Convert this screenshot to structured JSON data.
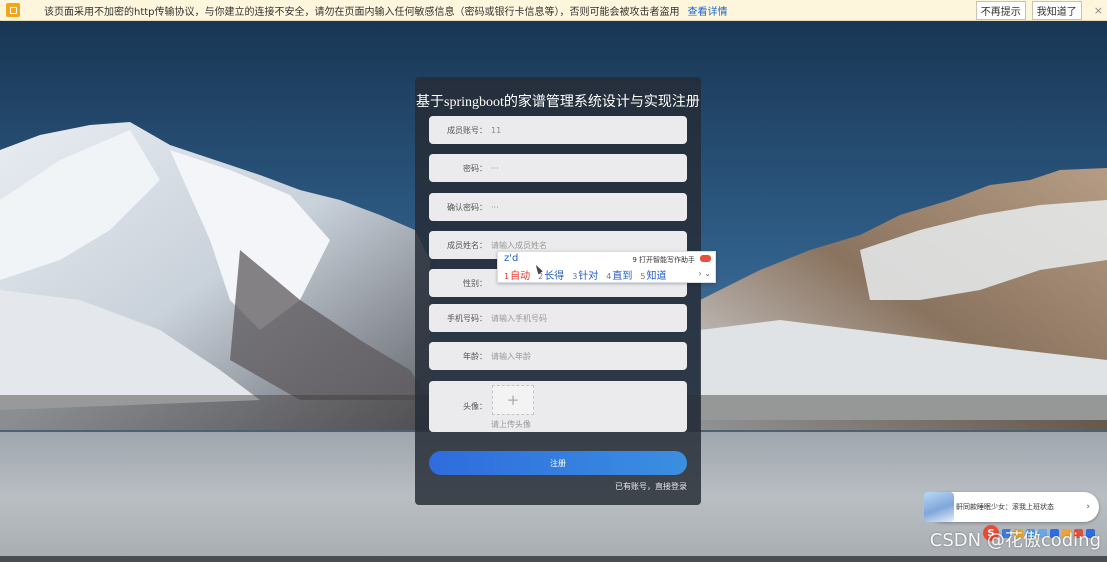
{
  "banner": {
    "message": "该页面采用不加密的http传输协议，与你建立的连接不安全，请勿在页面内输入任何敏感信息（密码或银行卡信息等），否则可能会被攻击者盗用",
    "details_link": "查看详情",
    "dont_remind": "不再提示",
    "got_it": "我知道了",
    "close": "×"
  },
  "form": {
    "title": "基于springboot的家谱管理系统设计与实现注册",
    "fields": [
      {
        "label": "成员账号：",
        "value": "11",
        "placeholder": ""
      },
      {
        "label": "密码：",
        "value": "···",
        "placeholder": ""
      },
      {
        "label": "确认密码：",
        "value": "···",
        "placeholder": ""
      },
      {
        "label": "成员姓名：",
        "value": "",
        "placeholder": "请输入成员姓名"
      },
      {
        "label": "性别：",
        "value": "",
        "placeholder": ""
      },
      {
        "label": "手机号码：",
        "value": "",
        "placeholder": "请输入手机号码"
      },
      {
        "label": "年龄：",
        "value": "",
        "placeholder": "请输入年龄"
      }
    ],
    "avatar": {
      "label": "头像：",
      "plus": "+",
      "hint": "请上传头像"
    },
    "submit": "注册",
    "login_link": "已有账号，直接登录"
  },
  "ime_popup": {
    "composition": "z'd",
    "assistant": "9 打开智能写作助手",
    "candidates": [
      {
        "num": "1",
        "text": "自动",
        "selected": true
      },
      {
        "num": "2",
        "text": "长得",
        "selected": false
      },
      {
        "num": "3",
        "text": "针对",
        "selected": false
      },
      {
        "num": "4",
        "text": "直到",
        "selected": false
      },
      {
        "num": "5",
        "text": "知道",
        "selected": false
      }
    ],
    "pager": "› ⌄"
  },
  "notification": {
    "text": "鼾同款睡眠少女：滚我上班状态",
    "arrow": "›"
  },
  "ime_toolbar": {
    "logo": "S",
    "colors": [
      "#3b7be0",
      "#e1a62b",
      "#4a9be0",
      "#6aa7ea",
      "#2f6cde",
      "#f0a23a",
      "#e0503a",
      "#2f6cde"
    ]
  },
  "watermark": "CSDN @花傲coding"
}
